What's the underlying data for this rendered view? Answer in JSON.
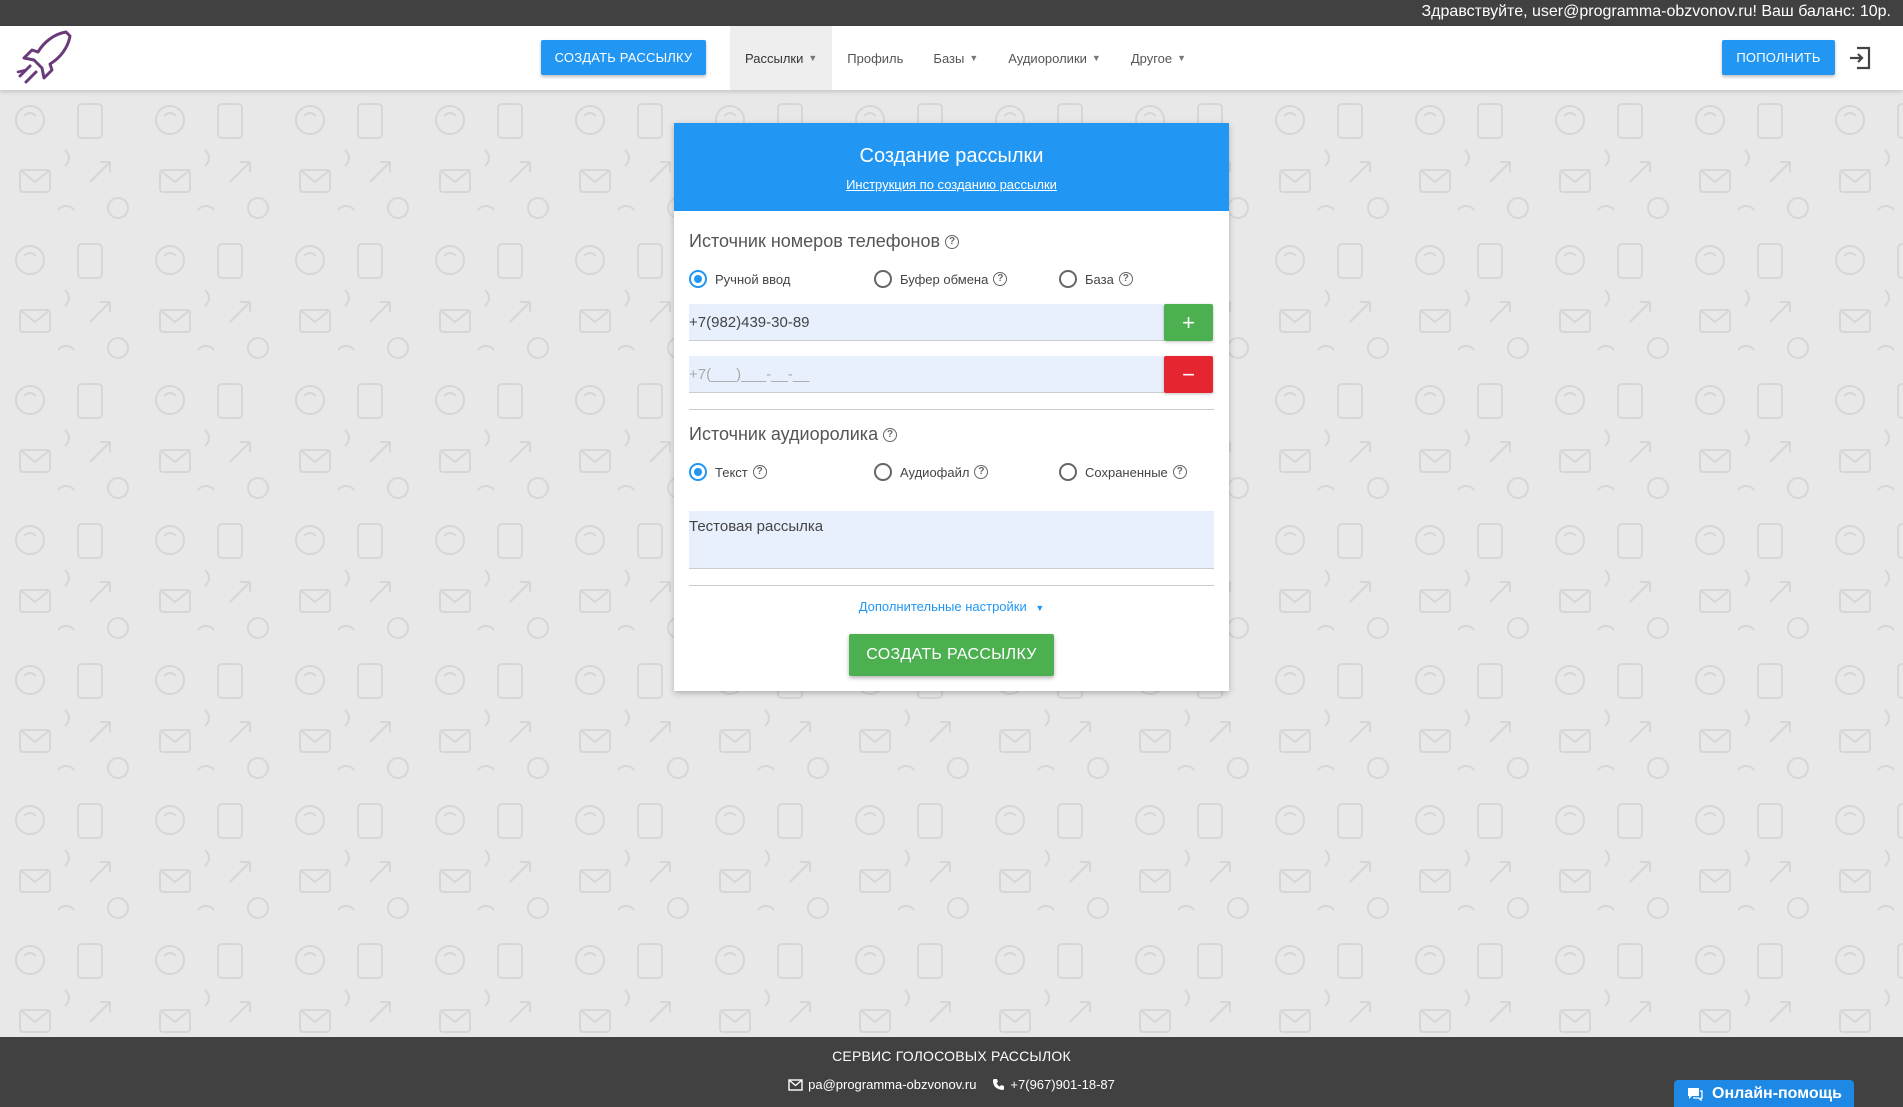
{
  "topbar": {
    "greeting": "Здравствуйте, user@programma-obzvonov.ru! Ваш баланс: 10р."
  },
  "nav": {
    "create_button": "СОЗДАТЬ РАССЫЛКУ",
    "items": [
      {
        "label": "Рассылки",
        "active": true,
        "dropdown": true
      },
      {
        "label": "Профиль",
        "active": false,
        "dropdown": false
      },
      {
        "label": "Базы",
        "active": false,
        "dropdown": true
      },
      {
        "label": "Аудиоролики",
        "active": false,
        "dropdown": true
      },
      {
        "label": "Другое",
        "active": false,
        "dropdown": true
      }
    ],
    "topup_button": "ПОПОЛНИТЬ"
  },
  "card": {
    "title": "Создание рассылки",
    "instruction_link": "Инструкция по созданию рассылки",
    "phone_source": {
      "title": "Источник номеров телефонов",
      "options": [
        "Ручной ввод",
        "Буфер обмена",
        "База"
      ],
      "selected": "Ручной ввод"
    },
    "phone_inputs": [
      {
        "value": "+7(982)439-30-89",
        "placeholder": ""
      },
      {
        "value": "",
        "placeholder": "+7(___)___-__-__"
      }
    ],
    "add_symbol": "+",
    "remove_symbol": "−",
    "audio_source": {
      "title": "Источник аудиоролика",
      "options": [
        "Текст",
        "Аудиофайл",
        "Сохраненные"
      ],
      "selected": "Текст"
    },
    "message_text": "Тестовая рассылка",
    "advanced_link": "Дополнительные настройки",
    "submit_button": "СОЗДАТЬ РАССЫЛКУ"
  },
  "footer": {
    "title": "СЕРВИС ГОЛОСОВЫХ РАССЫЛОК",
    "email": "pa@programma-obzvonov.ru",
    "phone": "+7(967)901-18-87"
  },
  "online_help": "Онлайн-помощь",
  "colors": {
    "primary": "#2196f3",
    "success": "#4caf50",
    "danger": "#e5252f",
    "dark": "#414141",
    "logo": "#6a3a7a"
  },
  "icons": {
    "logo": "rocket-icon",
    "logout": "logout-icon",
    "help": "question-circle-icon",
    "email": "envelope-icon",
    "phone": "phone-icon",
    "chat": "chat-bubble-icon"
  }
}
